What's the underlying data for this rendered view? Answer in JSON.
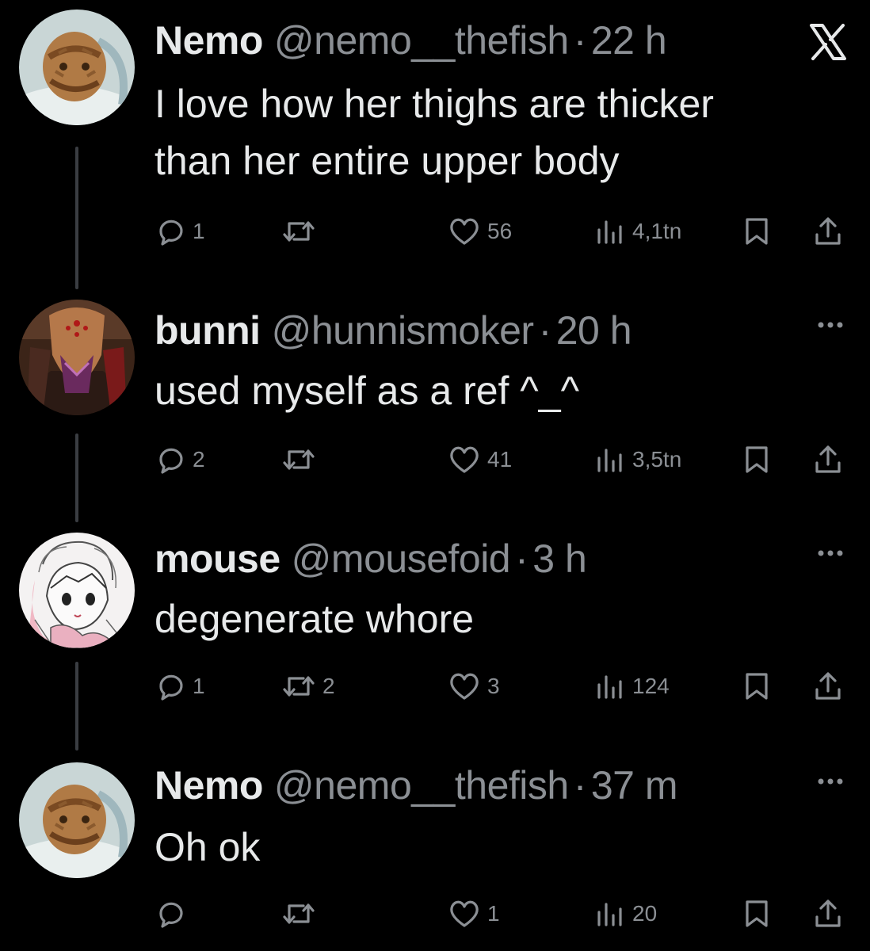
{
  "tweets": [
    {
      "name": "Nemo",
      "handle": "@nemo__thefish",
      "time": "22 h",
      "text_lines": [
        "I love how her thighs are thicker",
        "than her entire upper body"
      ],
      "replies": "1",
      "retweets": "",
      "likes": "56",
      "views": "4,1tn",
      "corner_icon": "x-logo-icon",
      "avatar": "rock-character-avatar"
    },
    {
      "name": "bunni",
      "handle": "@hunnismoker",
      "time": "20 h",
      "text_lines": [
        "used myself as a ref ^_^"
      ],
      "replies": "2",
      "retweets": "",
      "likes": "41",
      "views": "3,5tn",
      "corner_icon": "more-icon",
      "avatar": "helmet-character-avatar"
    },
    {
      "name": "mouse",
      "handle": "@mousefoid",
      "time": "3 h",
      "text_lines": [
        "degenerate whore"
      ],
      "replies": "1",
      "retweets": "2",
      "likes": "3",
      "views": "124",
      "corner_icon": "more-icon",
      "avatar": "sketch-anime-avatar"
    },
    {
      "name": "Nemo",
      "handle": "@nemo__thefish",
      "time": "37 m",
      "text_lines": [
        "Oh ok"
      ],
      "replies": "",
      "retweets": "",
      "likes": "1",
      "views": "20",
      "corner_icon": "more-icon",
      "avatar": "rock-character-avatar"
    }
  ],
  "separator": "·",
  "colors": {
    "background": "#000000",
    "text": "#e7e9ea",
    "muted": "#8b8f94",
    "thread_line": "#3a3d42"
  }
}
